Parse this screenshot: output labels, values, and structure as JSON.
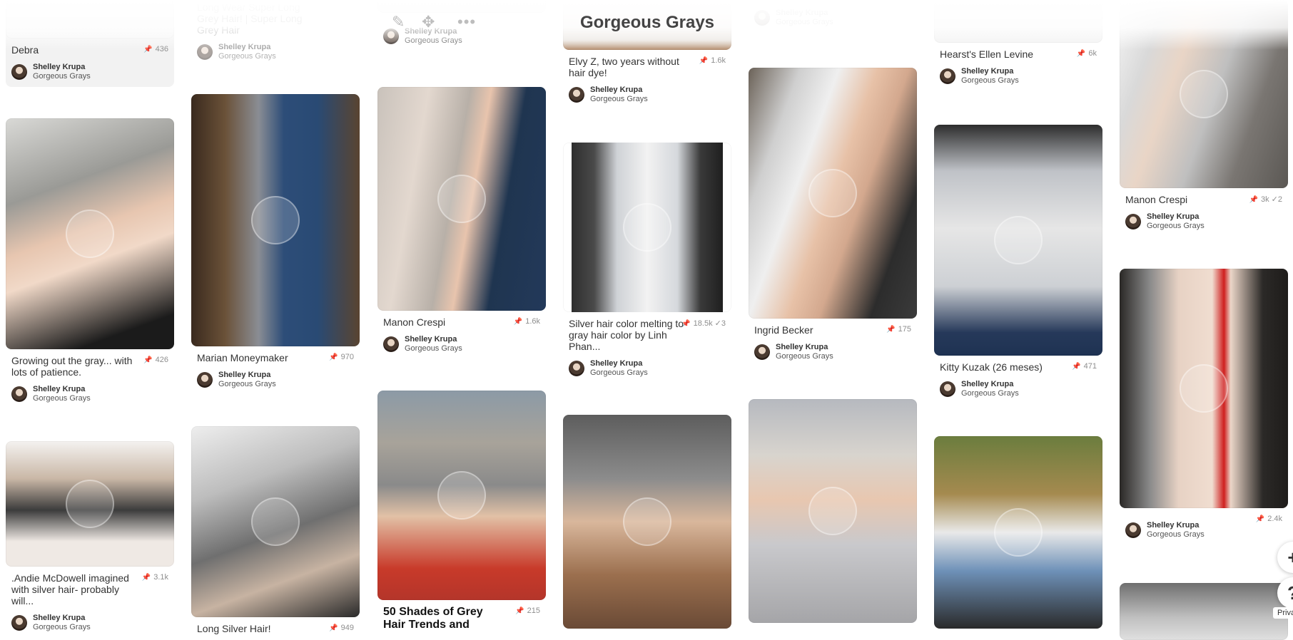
{
  "board": {
    "title": "Gorgeous Grays"
  },
  "toolbar": {
    "edit_icon": "pencil-icon",
    "move_icon": "move-arrows-icon",
    "more_icon": "ellipsis-icon"
  },
  "common": {
    "user": "Shelley Krupa",
    "board": "Gorgeous Grays"
  },
  "pins": {
    "p0": {
      "desc": "Debra",
      "saves": "436"
    },
    "p1": {
      "desc": "Growing out the gray... with lots of patience.",
      "saves": "426"
    },
    "p2": {
      "desc": ".Andie McDowell imagined with silver hair- probably will...",
      "saves": "3.1k"
    },
    "p3": {
      "desc": "Long Wear Super Long Grey Hair! | Super Long Grey Hair",
      "saves": ""
    },
    "p4": {
      "desc": "Marian Moneymaker",
      "saves": "970"
    },
    "p5": {
      "desc": "Long Silver Hair!",
      "saves": "949"
    },
    "p6": {
      "desc": "Manon Crespi",
      "saves": "1.6k"
    },
    "p7": {
      "desc": "50 Shades of Grey Hair Trends and",
      "saves": "215"
    },
    "p8": {
      "desc": "Elvy Z, two years without hair dye!",
      "saves": "1.6k"
    },
    "p9": {
      "desc": "Silver hair color melting to gray hair color by Linh Phan...",
      "saves": "18.5k",
      "comments": "3"
    },
    "p10": {
      "desc": "Ingrid Becker",
      "saves": "175"
    },
    "p11": {
      "desc": "Hearst's Ellen Levine",
      "saves": "6k"
    },
    "p12": {
      "desc": "Kitty Kuzak (26 meses)",
      "saves": "471"
    },
    "p13": {
      "desc": "Manon Crespi",
      "saves": "3k",
      "comments": "2"
    },
    "p14": {
      "desc": "",
      "saves": "2.4k"
    }
  },
  "colors": {
    "accent": "#e60023",
    "text": "#333333",
    "muted": "#8e8e8e"
  },
  "floating": {
    "add_label": "+",
    "help_label": "?",
    "privacy_label": "Privacy"
  }
}
